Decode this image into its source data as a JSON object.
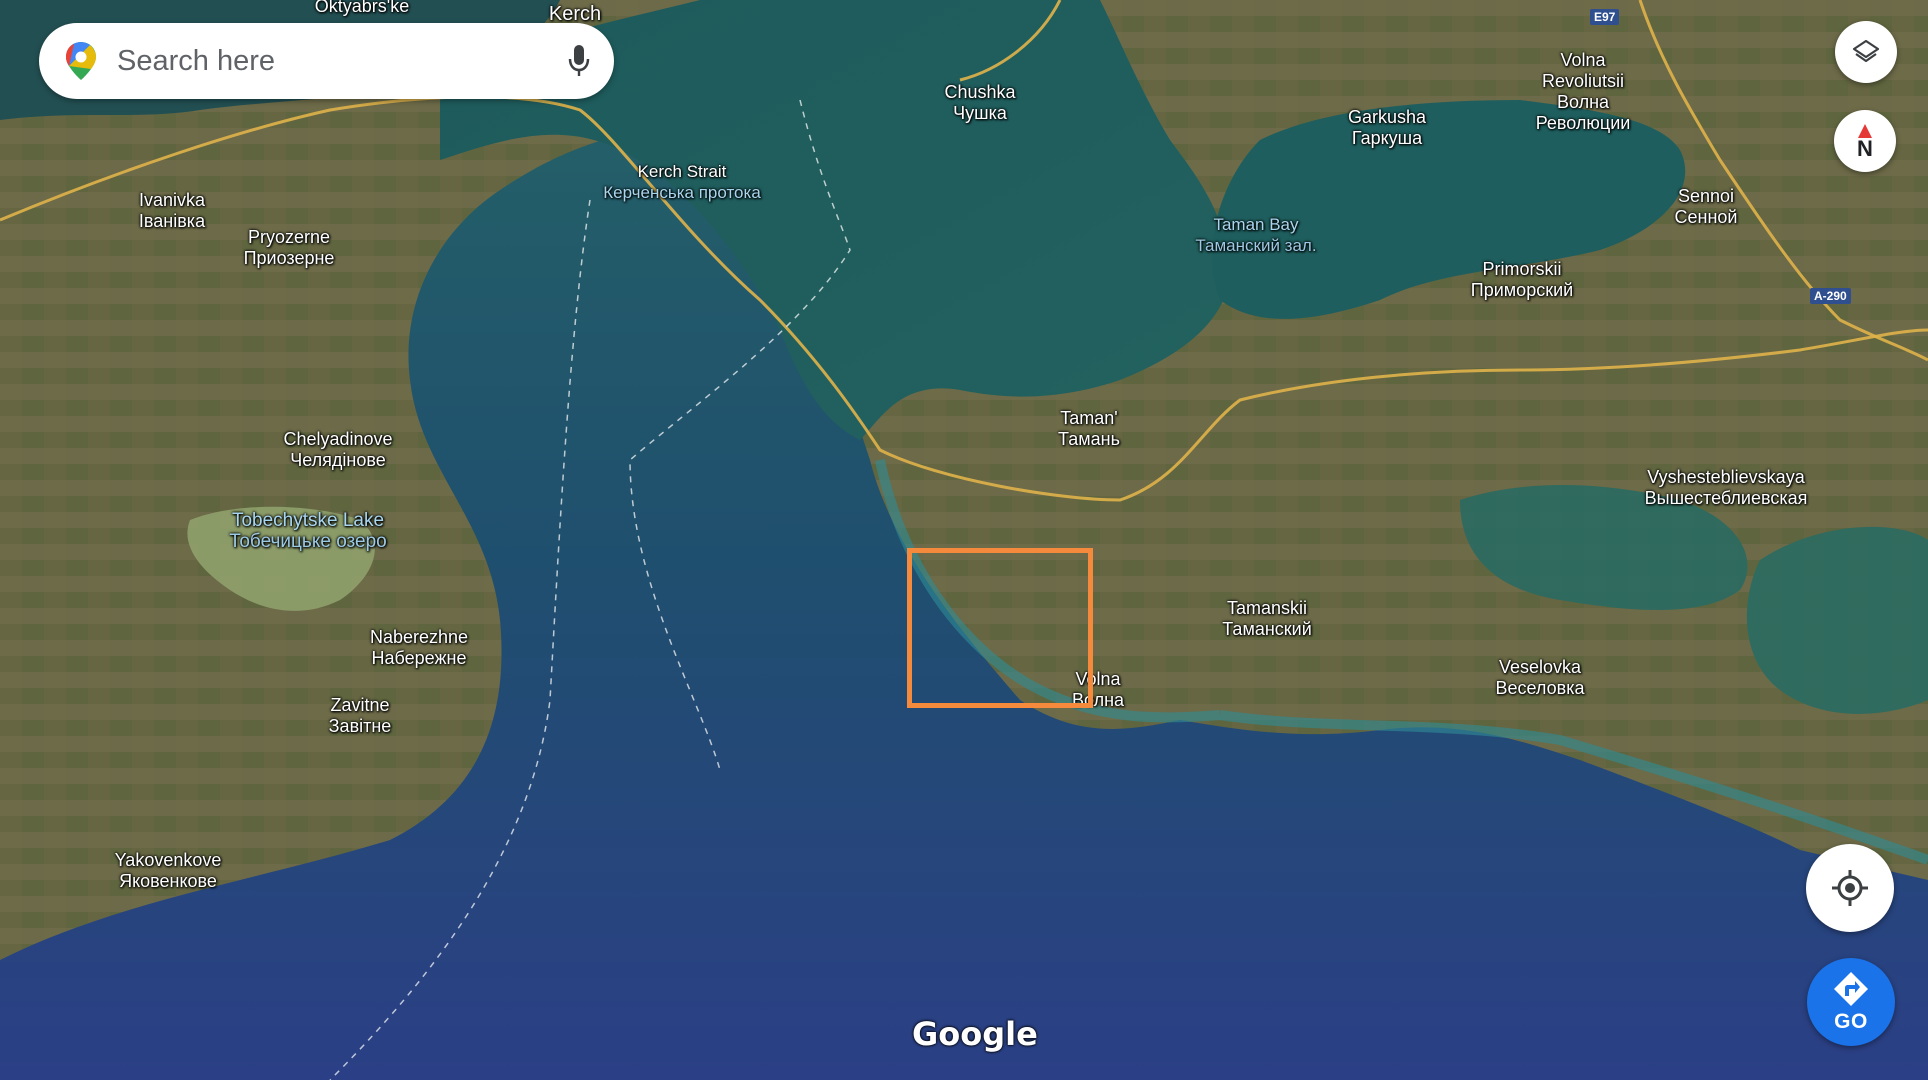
{
  "search": {
    "placeholder": "Search here"
  },
  "controls": {
    "layers": "layers-icon",
    "compass_label": "N",
    "my_location": "my-location-icon",
    "go_label": "GO"
  },
  "attribution": "Google",
  "road_badges": [
    "E97",
    "A-290"
  ],
  "places": [
    {
      "id": "kerch",
      "l1": "Kerch"
    },
    {
      "id": "oktyabrske",
      "l1": "Oktyabrs'ke"
    },
    {
      "id": "chushka",
      "l1": "Chushka",
      "l2": "Чушка"
    },
    {
      "id": "kerch-strait",
      "l1": "Kerch Strait",
      "l2": "Керченська протока"
    },
    {
      "id": "garkusha",
      "l1": "Garkusha",
      "l2": "Гаркуша"
    },
    {
      "id": "volna-rev",
      "l1": "Volna",
      "l2": "Revoliutsii",
      "l3": "Волна",
      "l4": "Революции"
    },
    {
      "id": "sennoi",
      "l1": "Sennoi",
      "l2": "Сенной"
    },
    {
      "id": "ivanivka",
      "l1": "Ivanivka",
      "l2": "Іванівка"
    },
    {
      "id": "pryozerne",
      "l1": "Pryozerne",
      "l2": "Приозерне"
    },
    {
      "id": "taman-bay",
      "l1": "Taman Bay",
      "l2": "Таманский зал."
    },
    {
      "id": "primorskii",
      "l1": "Primorskii",
      "l2": "Приморский"
    },
    {
      "id": "chelyadinove",
      "l1": "Chelyadinove",
      "l2": "Челядінове"
    },
    {
      "id": "taman",
      "l1": "Taman'",
      "l2": "Тамань"
    },
    {
      "id": "vyshesteblievskaya",
      "l1": "Vyshesteblievskaya",
      "l2": "Вышестеблиевская"
    },
    {
      "id": "tobechytske",
      "l1": "Tobechytske Lake",
      "l2": "Тобечицьке озеро"
    },
    {
      "id": "tamanskii",
      "l1": "Tamanskii",
      "l2": "Таманский"
    },
    {
      "id": "naberezhne",
      "l1": "Naberezhne",
      "l2": "Набережне"
    },
    {
      "id": "veselovka",
      "l1": "Veselovka",
      "l2": "Веселовка"
    },
    {
      "id": "volna",
      "l1": "Volna",
      "l2": "Волна"
    },
    {
      "id": "zavitne",
      "l1": "Zavitne",
      "l2": "Завітне"
    },
    {
      "id": "yakovenkove",
      "l1": "Yakovenkove",
      "l2": "Яковенкове"
    }
  ]
}
